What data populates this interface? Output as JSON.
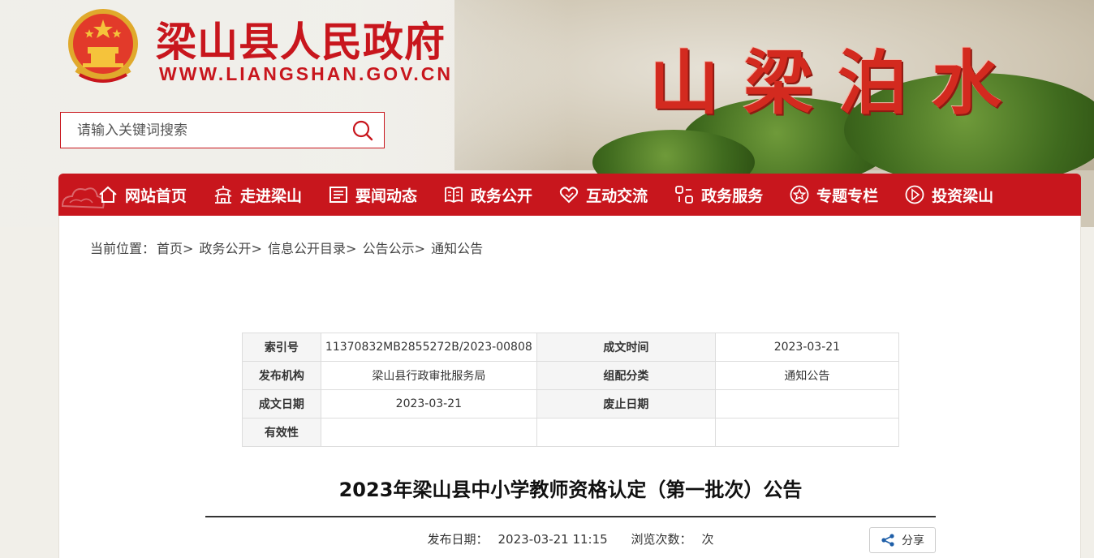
{
  "header": {
    "site_title": "梁山县人民政府",
    "site_url": "WWW.LIANGSHAN.GOV.CN",
    "banner_text": "山 梁 泊 水",
    "emblem_icon": "national-emblem-icon"
  },
  "search": {
    "placeholder": "请输入关键词搜索",
    "icon": "search-icon"
  },
  "nav": {
    "items": [
      {
        "label": "网站首页",
        "icon": "home-icon"
      },
      {
        "label": "走进梁山",
        "icon": "pagoda-icon"
      },
      {
        "label": "要闻动态",
        "icon": "newspaper-icon"
      },
      {
        "label": "政务公开",
        "icon": "book-icon"
      },
      {
        "label": "互动交流",
        "icon": "heart-icon"
      },
      {
        "label": "政务服务",
        "icon": "service-icon"
      },
      {
        "label": "专题专栏",
        "icon": "star-icon"
      },
      {
        "label": "投资梁山",
        "icon": "compass-icon"
      }
    ]
  },
  "breadcrumb": {
    "prefix": "当前位置：",
    "items": [
      "首页>",
      "政务公开>",
      "信息公开目录>",
      "公告公示>",
      "通知公告"
    ]
  },
  "meta": {
    "index_label": "索引号",
    "index_value": "11370832MB2855272B/2023-00808",
    "written_time_label": "成文时间",
    "written_time_value": "2023-03-21",
    "publisher_label": "发布机构",
    "publisher_value": "梁山县行政审批服务局",
    "category_label": "组配分类",
    "category_value": "通知公告",
    "written_date_label": "成文日期",
    "written_date_value": "2023-03-21",
    "abolish_date_label": "废止日期",
    "abolish_date_value": "",
    "validity_label": "有效性",
    "validity_value": ""
  },
  "article": {
    "title": "2023年梁山县中小学教师资格认定（第一批次）公告",
    "publish_label": "发布日期：",
    "publish_value": "2023-03-21 11:15",
    "views_label": "浏览次数：",
    "views_unit": "次",
    "share_label": "分享",
    "share_icon": "share-icon"
  },
  "colors": {
    "brand_red": "#c8161d"
  }
}
